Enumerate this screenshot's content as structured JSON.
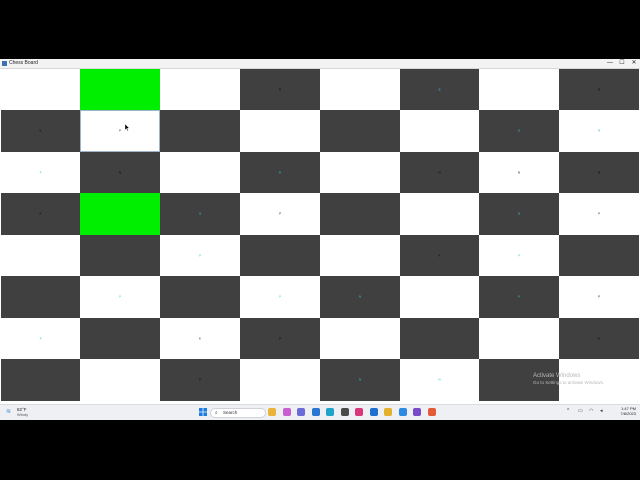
{
  "window": {
    "title": "Chess Board",
    "minimize": "—",
    "maximize": "☐",
    "close": "✕"
  },
  "board": {
    "squares": [
      [
        "light",
        "green",
        "light",
        "dark",
        "light",
        "dark",
        "light",
        "dark"
      ],
      [
        "dark",
        "light",
        "dark",
        "light",
        "dark",
        "light",
        "dark",
        "light"
      ],
      [
        "light",
        "dark",
        "light",
        "dark",
        "light",
        "dark",
        "light",
        "dark"
      ],
      [
        "dark",
        "green",
        "dark",
        "light",
        "dark",
        "light",
        "dark",
        "light"
      ],
      [
        "light",
        "dark",
        "light",
        "dark",
        "light",
        "dark",
        "light",
        "dark"
      ],
      [
        "dark",
        "light",
        "dark",
        "light",
        "dark",
        "light",
        "dark",
        "light"
      ],
      [
        "light",
        "dark",
        "light",
        "dark",
        "light",
        "dark",
        "light",
        "dark"
      ],
      [
        "dark",
        "light",
        "dark",
        "light",
        "dark",
        "light",
        "dark",
        "light"
      ]
    ],
    "selected": {
      "row": 1,
      "col": 1
    },
    "pieces": [
      {
        "row": 0,
        "col": 3,
        "glyph": "R",
        "color": "black"
      },
      {
        "row": 0,
        "col": 5,
        "glyph": "B",
        "color": "cyan"
      },
      {
        "row": 0,
        "col": 7,
        "glyph": "R",
        "color": "black"
      },
      {
        "row": 1,
        "col": 0,
        "glyph": "K",
        "color": "black"
      },
      {
        "row": 1,
        "col": 1,
        "glyph": "P",
        "color": "black"
      },
      {
        "row": 1,
        "col": 6,
        "glyph": "Q",
        "color": "cyan"
      },
      {
        "row": 1,
        "col": 7,
        "glyph": "N",
        "color": "cyan"
      },
      {
        "row": 2,
        "col": 0,
        "glyph": "P",
        "color": "cyan"
      },
      {
        "row": 2,
        "col": 1,
        "glyph": "N",
        "color": "black"
      },
      {
        "row": 2,
        "col": 3,
        "glyph": "R",
        "color": "cyan"
      },
      {
        "row": 2,
        "col": 5,
        "glyph": "N",
        "color": "black"
      },
      {
        "row": 2,
        "col": 6,
        "glyph": "B",
        "color": "black"
      },
      {
        "row": 2,
        "col": 7,
        "glyph": "N",
        "color": "black"
      },
      {
        "row": 3,
        "col": 0,
        "glyph": "K",
        "color": "black"
      },
      {
        "row": 3,
        "col": 2,
        "glyph": "Q",
        "color": "cyan"
      },
      {
        "row": 3,
        "col": 3,
        "glyph": "P",
        "color": "black"
      },
      {
        "row": 3,
        "col": 6,
        "glyph": "B",
        "color": "cyan"
      },
      {
        "row": 3,
        "col": 7,
        "glyph": "P",
        "color": "black"
      },
      {
        "row": 4,
        "col": 2,
        "glyph": "P",
        "color": "cyan"
      },
      {
        "row": 4,
        "col": 5,
        "glyph": "K",
        "color": "black"
      },
      {
        "row": 4,
        "col": 6,
        "glyph": "P",
        "color": "cyan"
      },
      {
        "row": 5,
        "col": 1,
        "glyph": "P",
        "color": "cyan"
      },
      {
        "row": 5,
        "col": 3,
        "glyph": "P",
        "color": "cyan"
      },
      {
        "row": 5,
        "col": 4,
        "glyph": "N",
        "color": "cyan"
      },
      {
        "row": 5,
        "col": 6,
        "glyph": "P",
        "color": "cyan"
      },
      {
        "row": 5,
        "col": 7,
        "glyph": "P",
        "color": "black"
      },
      {
        "row": 6,
        "col": 0,
        "glyph": "P",
        "color": "cyan"
      },
      {
        "row": 6,
        "col": 2,
        "glyph": "K",
        "color": "black"
      },
      {
        "row": 6,
        "col": 3,
        "glyph": "P",
        "color": "black"
      },
      {
        "row": 6,
        "col": 7,
        "glyph": "K",
        "color": "black"
      },
      {
        "row": 7,
        "col": 2,
        "glyph": "P",
        "color": "black"
      },
      {
        "row": 7,
        "col": 4,
        "glyph": "N",
        "color": "cyan"
      },
      {
        "row": 7,
        "col": 5,
        "glyph": "N",
        "color": "cyan"
      }
    ]
  },
  "watermark": {
    "title": "Activate Windows",
    "subtitle": "Go to Settings to activate Windows."
  },
  "taskbar": {
    "weather_temp": "82°F",
    "weather_cond": "Windy",
    "search_label": "Search",
    "apps": [
      {
        "name": "file-explorer-icon",
        "color": "#e8b53a"
      },
      {
        "name": "photos-icon",
        "color": "#c75fd0"
      },
      {
        "name": "chat-icon",
        "color": "#6a6ad9"
      },
      {
        "name": "store-icon",
        "color": "#2a76d2"
      },
      {
        "name": "edge-icon",
        "color": "#1fa3c9"
      },
      {
        "name": "settings-icon",
        "color": "#4a4a4a"
      },
      {
        "name": "media-icon",
        "color": "#d9357b"
      },
      {
        "name": "mail-icon",
        "color": "#1f6fd1"
      },
      {
        "name": "chrome-icon",
        "color": "#e5b12d"
      },
      {
        "name": "vscode-icon",
        "color": "#2d8ae0"
      },
      {
        "name": "visual-studio-icon",
        "color": "#7a4bc9"
      },
      {
        "name": "app-icon",
        "color": "#e15b3a"
      }
    ],
    "time": "1:47 PM",
    "date": "7/8/2023"
  }
}
